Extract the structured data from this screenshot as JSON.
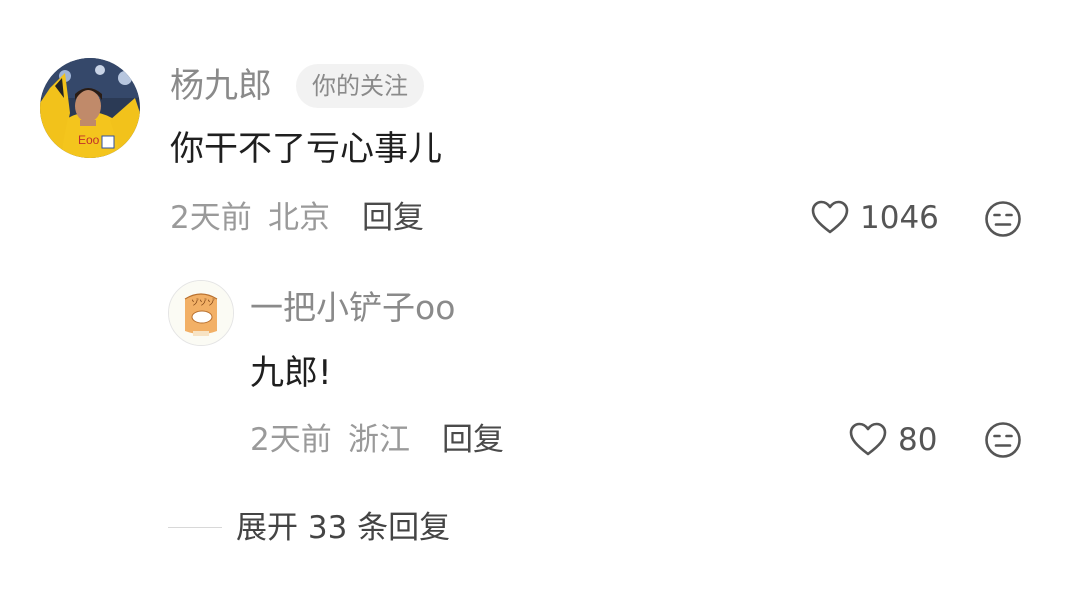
{
  "comment": {
    "author": "杨九郎",
    "badge": "你的关注",
    "text": "你干不了亏心事儿",
    "time": "2天前",
    "location": "北京",
    "reply_label": "回复",
    "like_count": "1046",
    "icons": [
      "avatar",
      "heart-icon",
      "dislike-face-icon"
    ]
  },
  "reply": {
    "author": "一把小铲子oo",
    "text": "九郎!",
    "time": "2天前",
    "location": "浙江",
    "reply_label": "回复",
    "like_count": "80",
    "icons": [
      "avatar",
      "heart-icon",
      "dislike-face-icon"
    ]
  },
  "expand": {
    "label": "展开 33 条回复"
  },
  "colors": {
    "username": "#8a8a8a",
    "meta": "#9a9a9a",
    "text": "#1f1f1f",
    "badge_bg": "#f2f2f2"
  }
}
